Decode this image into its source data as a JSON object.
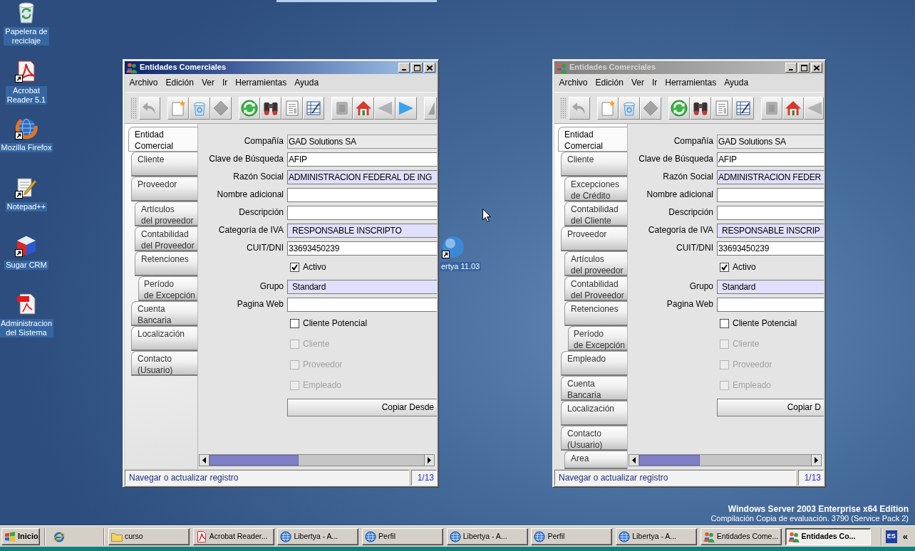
{
  "desktop_icons": [
    {
      "label": "Papelera de\nreciclaje",
      "kind": "recycle-bin",
      "shortcut": false
    },
    {
      "label": "Acrobat\nReader 5.1",
      "kind": "acrobat",
      "shortcut": true
    },
    {
      "label": "Mozilla Firefox",
      "kind": "firefox",
      "shortcut": true
    },
    {
      "label": "Notepad++",
      "kind": "notepad",
      "shortcut": true
    },
    {
      "label": "Sugar CRM",
      "kind": "cube",
      "shortcut": true
    },
    {
      "label": "Administracion\ndel Sistema",
      "kind": "pdf",
      "shortcut": false
    },
    {
      "label": "ertya 11.03",
      "kind": "sphere",
      "shortcut": true
    }
  ],
  "windows": [
    {
      "title": "Entidades Comerciales",
      "active": true,
      "menu": [
        "Archivo",
        "Edición",
        "Ver",
        "Ir",
        "Herramientas",
        "Ayuda"
      ],
      "toolbar": [
        [
          {
            "kind": "undo",
            "disabled": true
          }
        ],
        [
          {
            "kind": "new",
            "disabled": false
          },
          {
            "kind": "delete",
            "disabled": false
          },
          {
            "kind": "save",
            "disabled": true
          }
        ],
        [
          {
            "kind": "refresh",
            "disabled": false
          },
          {
            "kind": "find",
            "disabled": false
          },
          {
            "kind": "report",
            "disabled": false
          },
          {
            "kind": "form",
            "disabled": false
          }
        ],
        [
          {
            "kind": "attachment",
            "disabled": true
          },
          {
            "kind": "home",
            "disabled": false
          },
          {
            "kind": "previous",
            "disabled": true
          },
          {
            "kind": "next",
            "disabled": false
          }
        ],
        [
          {
            "kind": "last",
            "disabled": true
          }
        ]
      ],
      "tabs": [
        {
          "label": "Entidad\nComercial",
          "selected": true
        },
        {
          "label": "Cliente",
          "selected": false
        },
        {
          "label": "Proveedor",
          "selected": false,
          "children": [
            {
              "label": "Artículos\ndel proveedor",
              "selected": false
            },
            {
              "label": "Contabilidad\ndel Proveedor",
              "selected": false
            },
            {
              "label": "Retenciones",
              "selected": false,
              "children": [
                {
                  "label": "Período\nde Excepción",
                  "selected": false
                }
              ]
            }
          ]
        },
        {
          "label": "Cuenta\nBancaria",
          "selected": false
        },
        {
          "label": "Localización",
          "selected": false
        },
        {
          "label": "Contacto\n(Usuario)",
          "selected": false
        }
      ],
      "fields": [
        {
          "kind": "text",
          "label": "Compañía",
          "value": "GAD Solutions SA",
          "readonly": true,
          "mandatory": false
        },
        {
          "kind": "text",
          "label": "Clave de Búsqueda",
          "value": "AFIP",
          "readonly": false,
          "mandatory": false
        },
        {
          "kind": "text",
          "label": "Razón Social",
          "value": "ADMINISTRACION FEDERAL DE ING",
          "readonly": false,
          "mandatory": true
        },
        {
          "kind": "text",
          "label": "Nombre adicional",
          "readonly": false,
          "mandatory": false
        },
        {
          "kind": "text",
          "label": "Descripción",
          "readonly": false,
          "mandatory": false
        },
        {
          "kind": "select",
          "label": "Categoría de IVA",
          "value": "RESPONSABLE INSCRIPTO",
          "readonly": false,
          "mandatory": true
        },
        {
          "kind": "text",
          "label": "CUIT/DNI",
          "value": "33693450239",
          "readonly": false,
          "mandatory": false
        },
        {
          "kind": "checkbox",
          "label": "Activo",
          "checked": true,
          "disabled": false
        },
        {
          "kind": "select",
          "label": "Grupo",
          "value": "Standard",
          "readonly": false,
          "mandatory": true
        },
        {
          "kind": "text",
          "label": "Pagina Web",
          "readonly": false,
          "mandatory": false
        },
        {
          "kind": "checkbox",
          "label": "Cliente Potencial",
          "checked": false,
          "disabled": false
        },
        {
          "kind": "checkbox",
          "label": "Cliente",
          "checked": false,
          "disabled": true
        },
        {
          "kind": "checkbox",
          "label": "Proveedor",
          "checked": false,
          "disabled": true
        },
        {
          "kind": "checkbox",
          "label": "Empleado",
          "checked": false,
          "disabled": true
        },
        {
          "kind": "button",
          "label": "Copiar Desde"
        }
      ],
      "status": "Navegar o actualizar registro",
      "record_count": "1/13"
    },
    {
      "title": "Entidades Comerciales",
      "active": false,
      "menu": [
        "Archivo",
        "Edición",
        "Ver",
        "Ir",
        "Herramientas",
        "Ayuda"
      ],
      "toolbar": [
        [
          {
            "kind": "undo",
            "disabled": true
          }
        ],
        [
          {
            "kind": "new",
            "disabled": false
          },
          {
            "kind": "delete",
            "disabled": false
          },
          {
            "kind": "save",
            "disabled": true
          }
        ],
        [
          {
            "kind": "refresh",
            "disabled": false
          },
          {
            "kind": "find",
            "disabled": false
          },
          {
            "kind": "report",
            "disabled": false
          },
          {
            "kind": "form",
            "disabled": false
          }
        ],
        [
          {
            "kind": "attachment",
            "disabled": true
          },
          {
            "kind": "home",
            "disabled": false
          },
          {
            "kind": "previous",
            "disabled": true
          }
        ]
      ],
      "tabs": [
        {
          "label": "Entidad\nComercial",
          "selected": true
        },
        {
          "label": "Cliente",
          "selected": false,
          "children": [
            {
              "label": "Excepciones\nde Crédito",
              "selected": false
            },
            {
              "label": "Contabilidad\ndel Cliente",
              "selected": false
            }
          ]
        },
        {
          "label": "Proveedor",
          "selected": false,
          "children": [
            {
              "label": "Artículos\ndel proveedor",
              "selected": false
            },
            {
              "label": "Contabilidad\ndel Proveedor",
              "selected": false
            },
            {
              "label": "Retenciones",
              "selected": false,
              "children": [
                {
                  "label": "Período\nde Excepción",
                  "selected": false
                }
              ]
            }
          ]
        },
        {
          "label": "Empleado",
          "selected": false
        },
        {
          "label": "Cuenta\nBancaria",
          "selected": false
        },
        {
          "label": "Localización",
          "selected": false
        },
        {
          "label": "Contacto\n(Usuario)",
          "selected": false,
          "children": [
            {
              "label": "Area",
              "selected": false
            }
          ]
        }
      ],
      "fields": [
        {
          "kind": "text",
          "label": "Compañía",
          "value": "GAD Solutions SA",
          "readonly": true,
          "mandatory": false
        },
        {
          "kind": "text",
          "label": "Clave de Búsqueda",
          "value": "AFIP",
          "readonly": false,
          "mandatory": false
        },
        {
          "kind": "text",
          "label": "Razón Social",
          "value": "ADMINISTRACION FEDER",
          "readonly": false,
          "mandatory": true
        },
        {
          "kind": "text",
          "label": "Nombre adicional",
          "readonly": false,
          "mandatory": false
        },
        {
          "kind": "text",
          "label": "Descripción",
          "readonly": false,
          "mandatory": false
        },
        {
          "kind": "select",
          "label": "Categoría de IVA",
          "value": "RESPONSABLE INSCRIP",
          "readonly": false,
          "mandatory": true
        },
        {
          "kind": "text",
          "label": "CUIT/DNI",
          "value": "33693450239",
          "readonly": false,
          "mandatory": false
        },
        {
          "kind": "checkbox",
          "label": "Activo",
          "checked": true,
          "disabled": false
        },
        {
          "kind": "select",
          "label": "Grupo",
          "value": "Standard",
          "readonly": false,
          "mandatory": true
        },
        {
          "kind": "text",
          "label": "Pagina Web",
          "readonly": false,
          "mandatory": false
        },
        {
          "kind": "checkbox",
          "label": "Cliente Potencial",
          "checked": false,
          "disabled": false
        },
        {
          "kind": "checkbox",
          "label": "Cliente",
          "checked": false,
          "disabled": true
        },
        {
          "kind": "checkbox",
          "label": "Proveedor",
          "checked": false,
          "disabled": true
        },
        {
          "kind": "checkbox",
          "label": "Empleado",
          "checked": false,
          "disabled": true
        },
        {
          "kind": "button",
          "label": "Copiar D"
        }
      ],
      "status": "Navegar o actualizar registro",
      "record_count": "1/13"
    }
  ],
  "system_info": {
    "edition": "Windows Server 2003 Enterprise x64 Edition",
    "build": "Compilación Copia de evaluación. 3790 (Service Pack 2)"
  },
  "taskbar": {
    "start_button": "Inicio",
    "tasks": [
      {
        "label": "curso",
        "kind": "folder",
        "selected": false
      },
      {
        "label": "Acrobat Reader...",
        "kind": "document",
        "selected": false
      },
      {
        "label": "Libertya - A...",
        "kind": "globe",
        "selected": false
      },
      {
        "label": "Perfil",
        "kind": "globe",
        "selected": false
      },
      {
        "label": "Libertya - A...",
        "kind": "globe",
        "selected": false
      },
      {
        "label": "Perfil",
        "kind": "globe",
        "selected": false
      },
      {
        "label": "Libertya - A...",
        "kind": "globe",
        "selected": false
      },
      {
        "label": "Entidades Come...",
        "kind": "people",
        "selected": false
      },
      {
        "label": "Entidades Co...",
        "kind": "people",
        "selected": true
      }
    ],
    "language": "ES",
    "tray_toggle": "«"
  }
}
